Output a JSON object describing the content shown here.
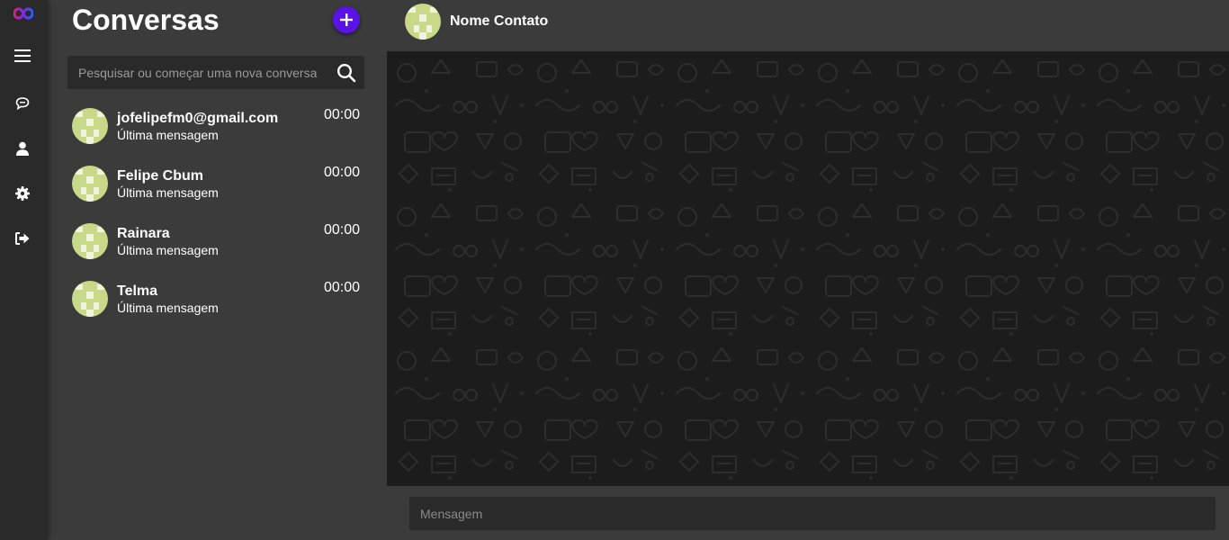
{
  "colors": {
    "accent": "#5b12e6",
    "rail_bg": "#2a2a2a",
    "panel_bg": "#3b3b3b",
    "chat_bg": "#1c1c1c",
    "avatar_bg": "#c8d98a"
  },
  "rail": {
    "logo_icon": "infinity-logo",
    "items": [
      {
        "icon": "menu-icon"
      },
      {
        "icon": "chat-icon"
      },
      {
        "icon": "user-icon"
      },
      {
        "icon": "gear-icon"
      },
      {
        "icon": "logout-icon"
      }
    ]
  },
  "conversations_panel": {
    "title": "Conversas",
    "add_button_icon": "plus-icon",
    "search_placeholder": "Pesquisar ou começar uma nova conversa",
    "items": [
      {
        "name": "jofelipefm0@gmail.com",
        "last_message": "Última mensagem",
        "time": "00:00"
      },
      {
        "name": "Felipe Cbum",
        "last_message": "Última mensagem",
        "time": "00:00"
      },
      {
        "name": "Rainara",
        "last_message": "Última mensagem",
        "time": "00:00"
      },
      {
        "name": "Telma",
        "last_message": "Última mensagem",
        "time": "00:00"
      }
    ]
  },
  "chat": {
    "contact_name": "Nome Contato",
    "message_placeholder": "Mensagem"
  }
}
